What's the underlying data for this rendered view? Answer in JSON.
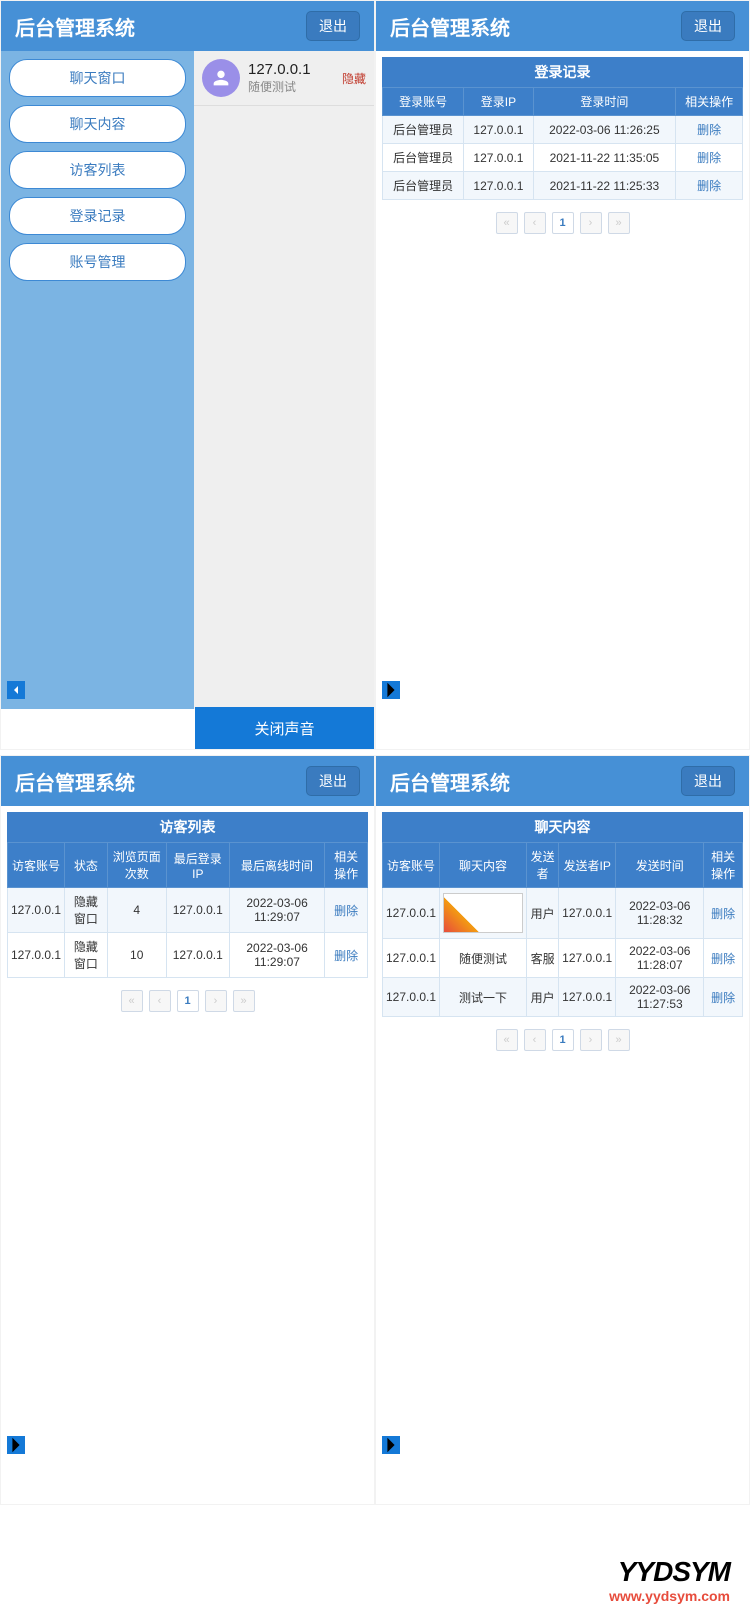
{
  "app_title": "后台管理系统",
  "logout": "退出",
  "sidebar": {
    "items": [
      {
        "label": "聊天窗口"
      },
      {
        "label": "聊天内容"
      },
      {
        "label": "访客列表"
      },
      {
        "label": "登录记录"
      },
      {
        "label": "账号管理"
      }
    ]
  },
  "chat_item": {
    "ip": "127.0.0.1",
    "msg": "随便测试",
    "hide": "隐藏"
  },
  "sound_btn": "关闭声音",
  "login_log": {
    "title": "登录记录",
    "headers": [
      "登录账号",
      "登录IP",
      "登录时间",
      "相关操作"
    ],
    "rows": [
      {
        "acc": "后台管理员",
        "ip": "127.0.0.1",
        "time": "2022-03-06 11:26:25",
        "op": "删除"
      },
      {
        "acc": "后台管理员",
        "ip": "127.0.0.1",
        "time": "2021-11-22 11:35:05",
        "op": "删除"
      },
      {
        "acc": "后台管理员",
        "ip": "127.0.0.1",
        "time": "2021-11-22 11:25:33",
        "op": "删除"
      }
    ]
  },
  "visitor": {
    "title": "访客列表",
    "headers": [
      "访客账号",
      "状态",
      "浏览页面次数",
      "最后登录IP",
      "最后离线时间",
      "相关操作"
    ],
    "rows": [
      {
        "acc": "127.0.0.1",
        "status": "隐藏窗口",
        "cnt": "4",
        "ip": "127.0.0.1",
        "time": "2022-03-06 11:29:07",
        "op": "删除"
      },
      {
        "acc": "127.0.0.1",
        "status": "隐藏窗口",
        "cnt": "10",
        "ip": "127.0.0.1",
        "time": "2022-03-06 11:29:07",
        "op": "删除"
      }
    ]
  },
  "chatlog": {
    "title": "聊天内容",
    "headers": [
      "访客账号",
      "聊天内容",
      "发送者",
      "发送者IP",
      "发送时间",
      "相关操作"
    ],
    "rows": [
      {
        "acc": "127.0.0.1",
        "content_type": "image",
        "sender": "用户",
        "ip": "127.0.0.1",
        "time": "2022-03-06 11:28:32",
        "op": "删除"
      },
      {
        "acc": "127.0.0.1",
        "content": "随便测试",
        "sender": "客服",
        "ip": "127.0.0.1",
        "time": "2022-03-06 11:28:07",
        "op": "删除"
      },
      {
        "acc": "127.0.0.1",
        "content": "测试一下",
        "sender": "用户",
        "ip": "127.0.0.1",
        "time": "2022-03-06 11:27:53",
        "op": "删除"
      }
    ]
  },
  "pager": {
    "first": "«",
    "prev": "‹",
    "page": "1",
    "next": "›",
    "last": "»"
  },
  "watermark": {
    "brand": "YYDSYM",
    "url": "www.yydsym.com"
  }
}
